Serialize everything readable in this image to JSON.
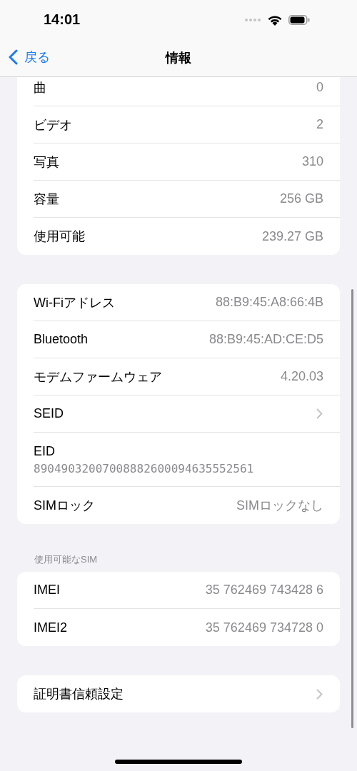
{
  "status_bar": {
    "time": "14:01"
  },
  "nav": {
    "back": "戻る",
    "title": "情報"
  },
  "groups": [
    {
      "rows": [
        {
          "kind": "value",
          "label": "曲",
          "value": "0"
        },
        {
          "kind": "value",
          "label": "ビデオ",
          "value": "2"
        },
        {
          "kind": "value",
          "label": "写真",
          "value": "310"
        },
        {
          "kind": "value",
          "label": "容量",
          "value": "256 GB"
        },
        {
          "kind": "value",
          "label": "使用可能",
          "value": "239.27 GB"
        }
      ]
    },
    {
      "rows": [
        {
          "kind": "value",
          "label": "Wi-Fiアドレス",
          "value": "88:B9:45:A8:66:4B"
        },
        {
          "kind": "value",
          "label": "Bluetooth",
          "value": "88:B9:45:AD:CE:D5"
        },
        {
          "kind": "value",
          "label": "モデムファームウェア",
          "value": "4.20.03"
        },
        {
          "kind": "link",
          "label": "SEID"
        },
        {
          "kind": "stacked",
          "label": "EID",
          "value": "89049032007008882600094635552561"
        },
        {
          "kind": "value",
          "label": "SIMロック",
          "value": "SIMロックなし"
        }
      ]
    },
    {
      "header": "使用可能なSIM",
      "rows": [
        {
          "kind": "value",
          "label": "IMEI",
          "value": "35 762469 743428 6"
        },
        {
          "kind": "value",
          "label": "IMEI2",
          "value": "35 762469 734728 0"
        }
      ]
    },
    {
      "rows": [
        {
          "kind": "link",
          "label": "証明書信頼設定"
        }
      ]
    }
  ]
}
